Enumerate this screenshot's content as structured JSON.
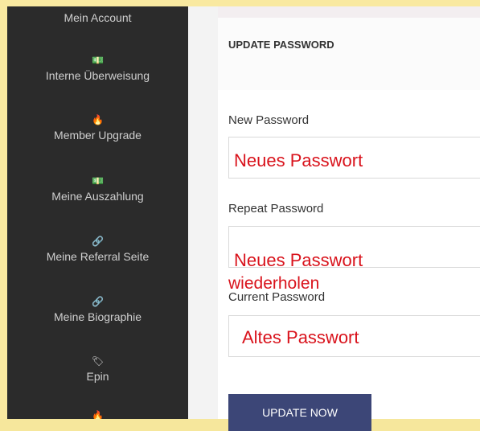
{
  "sidebar": {
    "items": [
      {
        "label": "Mein Account",
        "icon": ""
      },
      {
        "label": "Interne Überweisung",
        "icon": "💵"
      },
      {
        "label": "Member Upgrade",
        "icon": "🔥"
      },
      {
        "label": "Meine Auszahlung",
        "icon": "💵"
      },
      {
        "label": "Meine Referral Seite",
        "icon": "🔗"
      },
      {
        "label": "Meine Biographie",
        "icon": "🔗"
      },
      {
        "label": "Epin",
        "icon": "🏷"
      },
      {
        "label": "",
        "icon": "🔥"
      }
    ]
  },
  "form": {
    "title": "UPDATE PASSWORD",
    "new_password_label": "New Password",
    "repeat_password_label": "Repeat Password",
    "current_password_label": "Current Password",
    "submit_label": "UPDATE NOW"
  },
  "annotations": {
    "new_password": "Neues Passwort",
    "repeat_password_line1": "Neues Passwort",
    "repeat_password_line2": "wiederholen",
    "current_password": "Altes Passwort"
  },
  "colors": {
    "sidebar_bg": "#2b2b2b",
    "button_bg": "#3c4677",
    "annotation": "#d9131c",
    "frame": "#f9e9a0"
  }
}
